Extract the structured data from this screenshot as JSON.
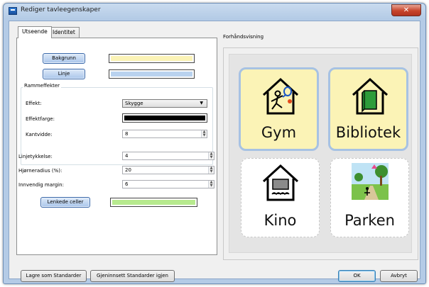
{
  "window": {
    "title": "Rediger tavleegenskaper",
    "close_symbol": "✕"
  },
  "tabs": [
    {
      "label": "Utseende",
      "active": true
    },
    {
      "label": "Identitet",
      "active": false
    }
  ],
  "appearance": {
    "background_button": "Bakgrunn",
    "background_color": "#fbf3b6",
    "line_button": "Linje",
    "line_color": "#b9d2ef",
    "frame_effects": {
      "title": "Rammeffekter",
      "effect_label": "Effekt:",
      "effect_value": "Skygge",
      "effect_color_label": "Effektfarge:",
      "effect_color": "#000000",
      "edge_width_label": "Kantvidde:",
      "edge_width_value": "8"
    },
    "line_thickness_label": "Linjetykkelse:",
    "line_thickness_value": "4",
    "corner_radius_label": "Hjørneradius (%):",
    "corner_radius_value": "20",
    "inner_margin_label": "Innvendig margin:",
    "inner_margin_value": "6",
    "linked_cells_button": "Lenkede celler",
    "linked_cells_color": "#b7ea8e"
  },
  "preview": {
    "title": "Forhåndsvisning",
    "cells": [
      {
        "word": "Gym",
        "icon": "gym-icon",
        "linked": true
      },
      {
        "word": "Bibliotek",
        "icon": "library-icon",
        "linked": true
      },
      {
        "word": "Kino",
        "icon": "cinema-icon",
        "linked": false
      },
      {
        "word": "Parken",
        "icon": "park-icon",
        "linked": false
      }
    ]
  },
  "footer": {
    "save_default": "Lagre som Standarder",
    "reset_default": "Gjeninnsett Standarder igjen",
    "ok": "OK",
    "cancel": "Avbryt"
  }
}
